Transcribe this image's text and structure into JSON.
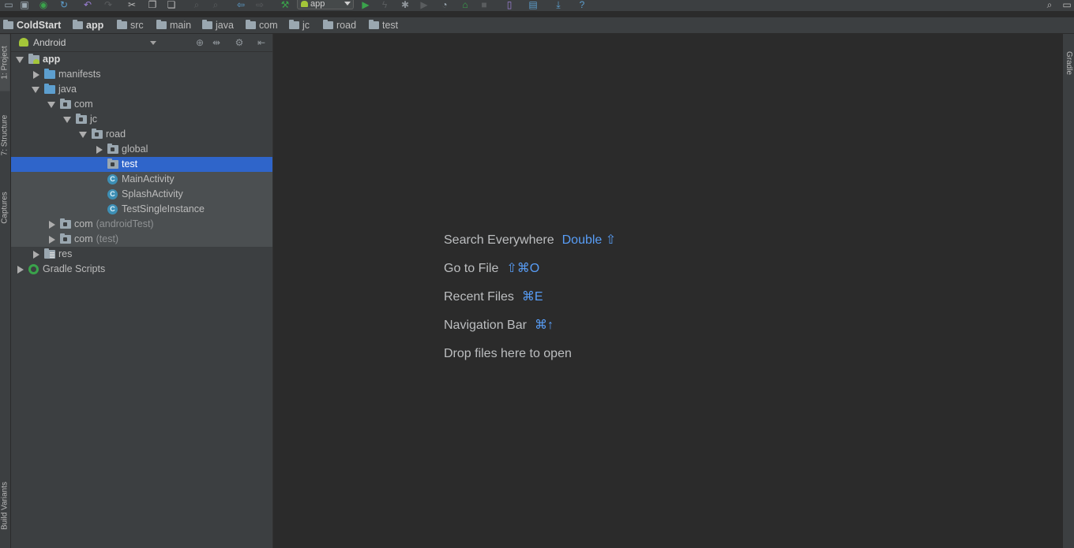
{
  "breadcrumb": {
    "items": [
      "ColdStart",
      "app",
      "src",
      "main",
      "java",
      "com",
      "jc",
      "road",
      "test"
    ]
  },
  "toolbar": {
    "run_config": "app"
  },
  "left_strip": {
    "tabs": [
      "1: Project",
      "7: Structure",
      "Captures",
      "Build Variants"
    ]
  },
  "right_strip": {
    "tabs": [
      "Gradle"
    ]
  },
  "project_panel": {
    "view_mode": "Android",
    "tree": [
      {
        "label": "app",
        "extra": "",
        "depth": 0,
        "expanded": true,
        "icon": "app-module-icon",
        "bold": true
      },
      {
        "label": "manifests",
        "extra": "",
        "depth": 1,
        "expanded": false,
        "icon": "folder-icon"
      },
      {
        "label": "java",
        "extra": "",
        "depth": 1,
        "expanded": true,
        "icon": "folder-icon"
      },
      {
        "label": "com",
        "extra": "",
        "depth": 2,
        "expanded": true,
        "icon": "package-icon"
      },
      {
        "label": "jc",
        "extra": "",
        "depth": 3,
        "expanded": true,
        "icon": "package-icon"
      },
      {
        "label": "road",
        "extra": "",
        "depth": 4,
        "expanded": true,
        "icon": "package-icon"
      },
      {
        "label": "global",
        "extra": "",
        "depth": 5,
        "expanded": false,
        "icon": "package-icon"
      },
      {
        "label": "test",
        "extra": "",
        "depth": 5,
        "selected": true,
        "icon": "package-icon"
      },
      {
        "label": "MainActivity",
        "extra": "",
        "depth": 5,
        "icon": "class-icon"
      },
      {
        "label": "SplashActivity",
        "extra": "",
        "depth": 5,
        "icon": "class-icon"
      },
      {
        "label": "TestSingleInstance",
        "extra": "",
        "depth": 5,
        "icon": "class-icon"
      },
      {
        "label": "com",
        "extra": "(androidTest)",
        "depth": 2,
        "expanded": false,
        "icon": "package-icon"
      },
      {
        "label": "com",
        "extra": "(test)",
        "depth": 2,
        "expanded": false,
        "icon": "package-icon"
      },
      {
        "label": "res",
        "extra": "",
        "depth": 1,
        "expanded": false,
        "icon": "res-folder-icon"
      },
      {
        "label": "Gradle Scripts",
        "extra": "",
        "depth": 0,
        "expanded": false,
        "icon": "gradle-icon"
      }
    ]
  },
  "editor": {
    "hints": [
      {
        "label": "Search Everywhere",
        "shortcut": "Double ⇧"
      },
      {
        "label": "Go to File",
        "shortcut": "⇧⌘O"
      },
      {
        "label": "Recent Files",
        "shortcut": "⌘E"
      },
      {
        "label": "Navigation Bar",
        "shortcut": "⌘↑"
      },
      {
        "label": "Drop files here to open",
        "shortcut": ""
      }
    ]
  },
  "colors": {
    "accent": "#589df6",
    "selection": "#2f65ca",
    "panel_bg": "#3c3f41",
    "editor_bg": "#2b2b2b"
  }
}
